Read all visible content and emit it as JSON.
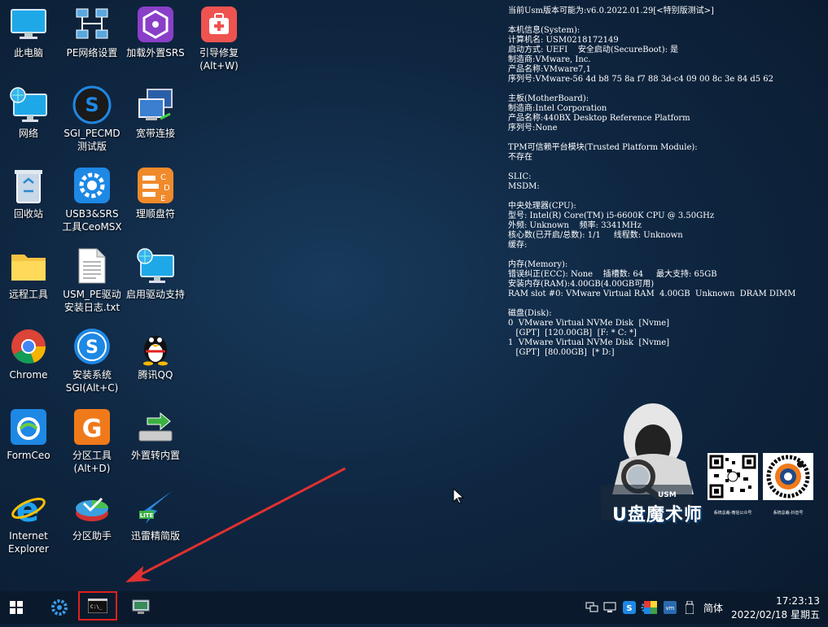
{
  "desktop_icons": [
    {
      "label": "此电脑"
    },
    {
      "label": "PE网络设置"
    },
    {
      "label": "加载外置SRS"
    },
    {
      "label": "引导修复\n(Alt+W)"
    },
    {
      "label": "网络"
    },
    {
      "label": "SGI_PECMD\n测试版"
    },
    {
      "label": "宽带连接"
    },
    {
      "label": "回收站"
    },
    {
      "label": "USB3&SRS\n工具CeoMSX"
    },
    {
      "label": "理顺盘符"
    },
    {
      "label": "远程工具"
    },
    {
      "label": "USM_PE驱动\n安装日志.txt"
    },
    {
      "label": "启用驱动支持"
    },
    {
      "label": "Chrome"
    },
    {
      "label": "安装系统\nSGI(Alt+C)"
    },
    {
      "label": "腾讯QQ"
    },
    {
      "label": "FormCeo"
    },
    {
      "label": "分区工具\n(Alt+D)"
    },
    {
      "label": "外置转内置"
    },
    {
      "label": "Internet\nExplorer"
    },
    {
      "label": "分区助手"
    },
    {
      "label": "迅雷精简版"
    }
  ],
  "sysinfo": {
    "lines": [
      "当前Usm版本可能为:v6.0.2022.01.29[<特别版测试>]",
      "",
      "本机信息(System):",
      "计算机名: USM0218172149",
      "启动方式: UEFI    安全启动(SecureBoot): 是",
      "制造商:VMware, Inc.",
      "产品名称:VMware7,1",
      "序列号:VMware-56 4d b8 75 8a f7 88 3d-c4 09 00 8c 3e 84 d5 62",
      "",
      "主板(MotherBoard):",
      "制造商:Intel Corporation",
      "产品名称:440BX Desktop Reference Platform",
      "序列号:None",
      "",
      "TPM可信赖平台模块(Trusted Platform Module):",
      "不存在",
      "",
      "SLIC:",
      "MSDM:",
      "",
      "中央处理器(CPU):",
      "型号: Intel(R) Core(TM) i5-6600K CPU @ 3.50GHz",
      "外频: Unknown    频率: 3341MHz",
      "核心数(已开启/总数): 1/1     线程数: Unknown",
      "缓存:",
      "",
      "内存(Memory):",
      "错误纠正(ECC): None    插槽数: 64     最大支持: 65GB",
      "安装内存(RAM):4.00GB(4.00GB可用)",
      "RAM slot #0: VMware Virtual RAM  4.00GB  Unknown  DRAM DIMM",
      "",
      "磁盘(Disk):",
      "0  VMware Virtual NVMe Disk  [Nvme]",
      "   [GPT]  [120.00GB]  [F: * C: *]",
      "1  VMware Virtual NVMe Disk  [Nvme]",
      "   [GPT]  [80.00GB]  [* D:]"
    ]
  },
  "branding": {
    "logo_text": "U盘魔术师",
    "logo_badge": "USM",
    "qr1_caption": "系统总裁-微信公众号",
    "qr2_caption": "系统总裁-抖音号"
  },
  "taskbar": {
    "ime_label": "简体",
    "time": "17:23:13",
    "date": "2022/02/18 星期五"
  },
  "colors": {
    "background": "#0f2742",
    "taskbar": "#0a1a2c",
    "highlight_box": "#e02020",
    "annotation_arrow": "#e03030"
  }
}
